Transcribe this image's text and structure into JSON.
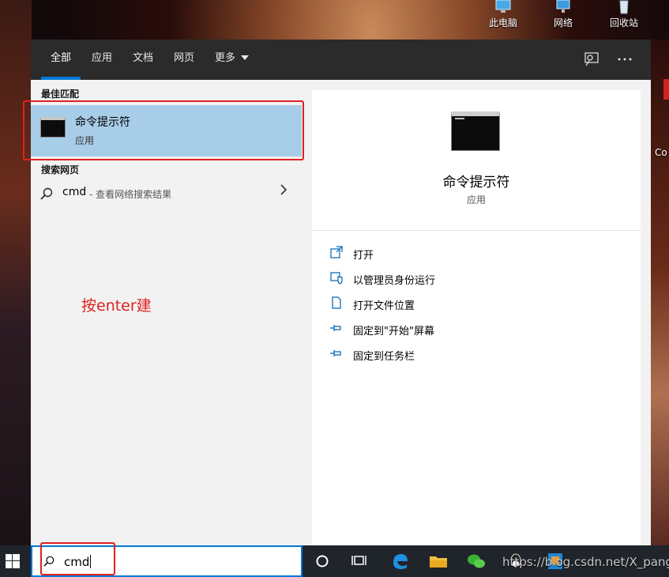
{
  "desktop": {
    "icons": [
      {
        "label": "此电脑",
        "icon": "computer-icon"
      },
      {
        "label": "网络",
        "icon": "network-icon"
      },
      {
        "label": "回收站",
        "icon": "recycle-bin-icon"
      }
    ],
    "side_text": "Co"
  },
  "tabs": [
    {
      "label": "全部",
      "active": true
    },
    {
      "label": "应用"
    },
    {
      "label": "文档"
    },
    {
      "label": "网页"
    },
    {
      "label": "更多"
    }
  ],
  "header_icons": [
    "feedback-icon",
    "more-options-icon"
  ],
  "best_match": {
    "heading": "最佳匹配",
    "title": "命令提示符",
    "subtitle": "应用",
    "icon": "command-prompt-icon"
  },
  "web_search": {
    "heading": "搜索网页",
    "query": "cmd",
    "hint": "- 查看网络搜索结果"
  },
  "annotation": "按enter建",
  "detail": {
    "title": "命令提示符",
    "subtitle": "应用",
    "actions": [
      {
        "label": "打开",
        "icon": "open-icon"
      },
      {
        "label": "以管理员身份运行",
        "icon": "run-as-admin-icon"
      },
      {
        "label": "打开文件位置",
        "icon": "file-location-icon"
      },
      {
        "label": "固定到\"开始\"屏幕",
        "icon": "pin-start-icon"
      },
      {
        "label": "固定到任务栏",
        "icon": "pin-taskbar-icon"
      }
    ]
  },
  "taskbar": {
    "search_value": "cmd",
    "watermark": "https://blog.csdn.net/X_pang",
    "apps": [
      "cortana-icon",
      "task-view-icon",
      "edge-icon",
      "file-explorer-icon",
      "wechat-icon",
      "qq-icon",
      "app-icon"
    ]
  },
  "colors": {
    "accent": "#0078d7",
    "selected": "#a8cde8",
    "highlight": "#e02020",
    "header": "#2b2b2b"
  }
}
